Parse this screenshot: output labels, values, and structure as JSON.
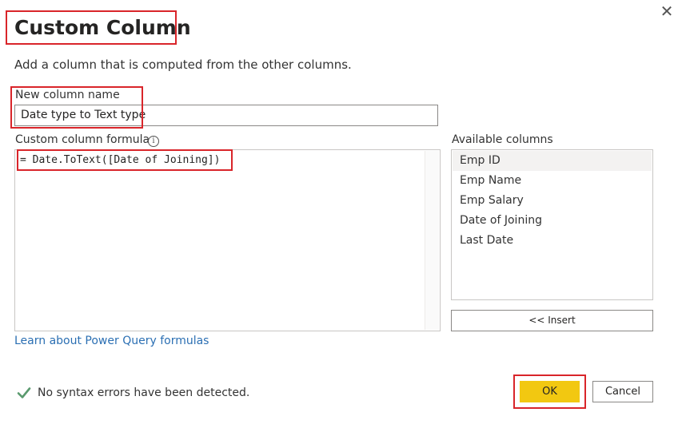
{
  "dialog": {
    "title": "Custom Column",
    "close_symbol": "✕",
    "description": "Add a column that is computed from the other columns."
  },
  "new_column": {
    "label": "New column name",
    "value": "Date type to Text type"
  },
  "formula": {
    "label": "Custom column formula",
    "info_symbol": "i",
    "value": "= Date.ToText([Date of Joining])"
  },
  "available_columns": {
    "label": "Available columns",
    "items": [
      "Emp ID",
      "Emp Name",
      "Emp Salary",
      "Date of Joining",
      "Last Date"
    ],
    "selected": "Emp ID"
  },
  "insert_button": "<< Insert",
  "learn_link": "Learn about Power Query formulas",
  "status": {
    "icon": "checkmark-icon",
    "text": "No syntax errors have been detected.",
    "color": "#5a9a6e"
  },
  "buttons": {
    "ok": "OK",
    "cancel": "Cancel"
  },
  "colors": {
    "ok_bg": "#f2c811",
    "highlight": "#d9252a",
    "link": "#2b6fb3"
  }
}
